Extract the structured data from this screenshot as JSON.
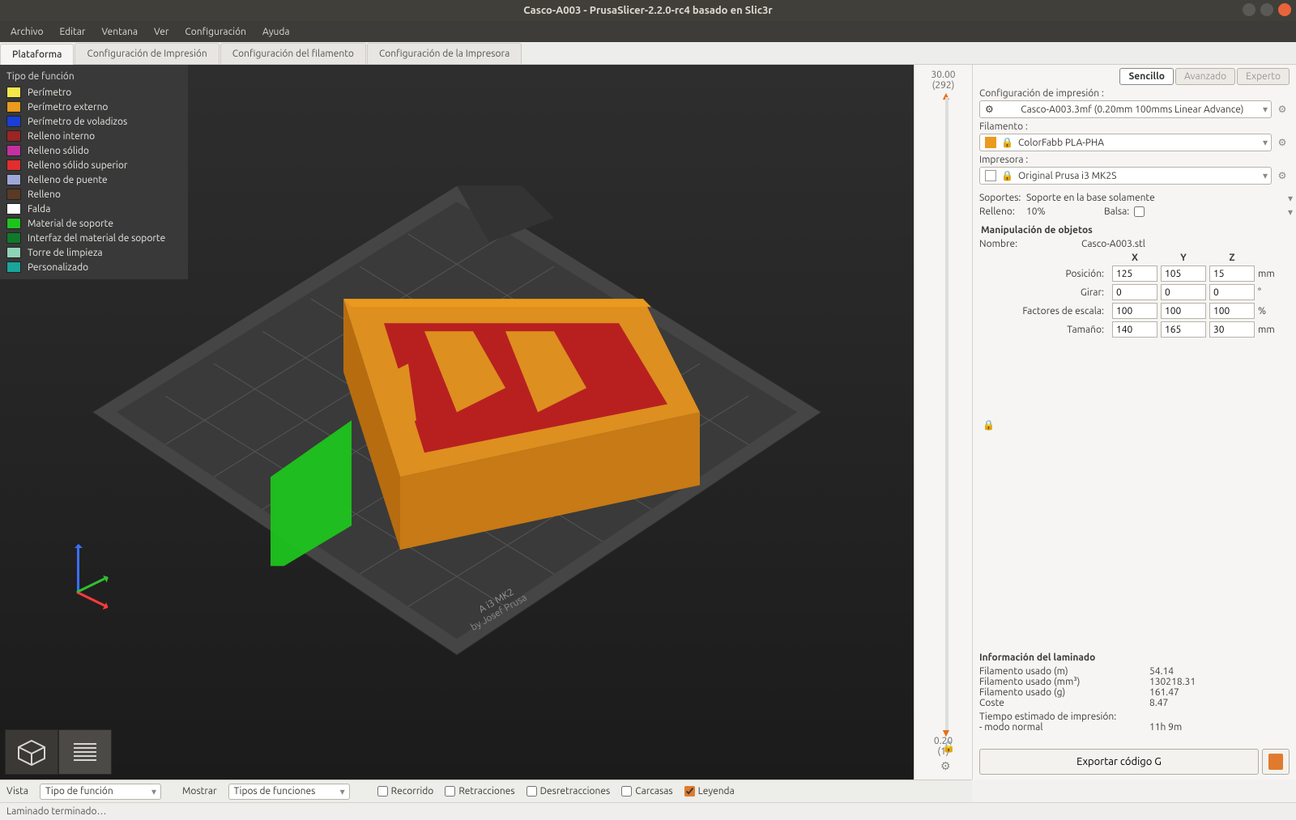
{
  "window": {
    "title": "Casco-A003 - PrusaSlicer-2.2.0-rc4 basado en Slic3r"
  },
  "menu": {
    "file": "Archivo",
    "edit": "Editar",
    "window": "Ventana",
    "view": "Ver",
    "config": "Configuración",
    "help": "Ayuda"
  },
  "tabs": {
    "plater": "Plataforma",
    "print": "Configuración de Impresión",
    "filament": "Configuración del filamento",
    "printer": "Configuración de la Impresora"
  },
  "legend": {
    "title": "Tipo de función",
    "items": [
      {
        "color": "#f5e74a",
        "label": "Perímetro"
      },
      {
        "color": "#ea9a1e",
        "label": "Perímetro externo"
      },
      {
        "color": "#1a3fd6",
        "label": "Perímetro de voladizos"
      },
      {
        "color": "#9c2424",
        "label": "Relleno interno"
      },
      {
        "color": "#c230a1",
        "label": "Relleno sólido"
      },
      {
        "color": "#e12e2e",
        "label": "Relleno sólido superior"
      },
      {
        "color": "#9fa7d8",
        "label": "Relleno de puente"
      },
      {
        "color": "#5a3a24",
        "label": "Relleno"
      },
      {
        "color": "#ffffff",
        "label": "Falda"
      },
      {
        "color": "#1ec41e",
        "label": "Material de soporte"
      },
      {
        "color": "#0f7a2a",
        "label": "Interfaz del material de soporte"
      },
      {
        "color": "#8fd4b8",
        "label": "Torre de limpieza"
      },
      {
        "color": "#1aa59a",
        "label": "Personalizado"
      }
    ]
  },
  "slider": {
    "top_val": "30.00",
    "top_layers": "(292)",
    "bot_val": "0.20",
    "bot_layers": "(1)"
  },
  "modes": {
    "simple": "Sencillo",
    "advanced": "Avanzado",
    "expert": "Experto"
  },
  "panel": {
    "print_label": "Configuración de impresión :",
    "print_value": "Casco-A003.3mf (0.20mm 100mms Linear Advance)",
    "filament_label": "Filamento :",
    "filament_value": "ColorFabb PLA-PHA",
    "printer_label": "Impresora :",
    "printer_value": "Original Prusa i3 MK2S",
    "supports_label": "Soportes:",
    "supports_value": "Soporte en la base solamente",
    "infill_label": "Relleno:",
    "infill_value": "10%",
    "raft_label": "Balsa:"
  },
  "obj": {
    "title": "Manipulación de objetos",
    "name_label": "Nombre:",
    "name_value": "Casco-A003.stl",
    "x": "X",
    "y": "Y",
    "z": "Z",
    "rows": {
      "pos": {
        "label": "Posición:",
        "x": "125",
        "y": "105",
        "z": "15",
        "unit": "mm"
      },
      "rot": {
        "label": "Girar:",
        "x": "0",
        "y": "0",
        "z": "0",
        "unit": "°"
      },
      "scale": {
        "label": "Factores de escala:",
        "x": "100",
        "y": "100",
        "z": "100",
        "unit": "%"
      },
      "size": {
        "label": "Tamaño:",
        "x": "140",
        "y": "165",
        "z": "30",
        "unit": "mm"
      }
    }
  },
  "sliced": {
    "title": "Información del laminado",
    "rows": [
      {
        "k": "Filamento usado (m)",
        "v": "54.14"
      },
      {
        "k": "Filamento usado (mm³)",
        "v": "130218.31"
      },
      {
        "k": "Filamento usado (g)",
        "v": "161.47"
      },
      {
        "k": "Coste",
        "v": "8.47"
      }
    ],
    "time_label": "Tiempo estimado de impresión:",
    "time_mode": "   - modo normal",
    "time_value": "11h 9m"
  },
  "export": {
    "button": "Exportar código G"
  },
  "bottom": {
    "view_label": "Vista",
    "view_value": "Tipo de función",
    "show_label": "Mostrar",
    "show_value": "Tipos de funciones",
    "travel": "Recorrido",
    "retract": "Retracciones",
    "unretract": "Desretracciones",
    "shells": "Carcasas",
    "legend": "Leyenda"
  },
  "status": {
    "text": "Laminado terminado…"
  }
}
